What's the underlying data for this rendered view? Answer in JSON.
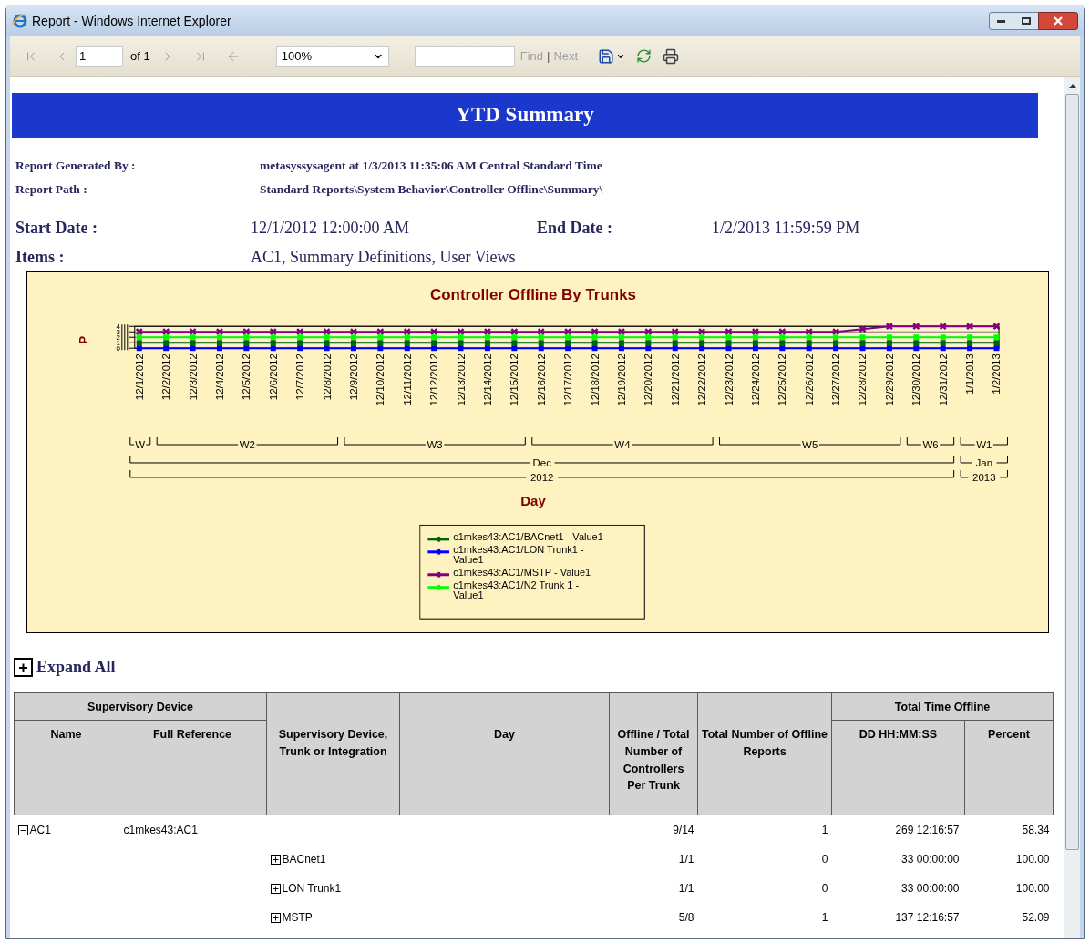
{
  "window": {
    "title": "Report - Windows Internet Explorer"
  },
  "toolbar": {
    "nav": [
      {
        "kind": "first",
        "disabled": true
      },
      {
        "kind": "prev",
        "disabled": true
      }
    ],
    "page": "1",
    "page_count": "of 1",
    "nav_after": [
      {
        "kind": "next",
        "disabled": true
      },
      {
        "kind": "last",
        "disabled": true
      },
      {
        "kind": "back",
        "disabled": true
      }
    ],
    "zoom": "100%",
    "find_label": "Find",
    "find_separator": "|",
    "next_label": "Next",
    "find_disabled": true
  },
  "report": {
    "title": "YTD Summary",
    "meta": [
      {
        "label": "Report Generated By :",
        "value": "metasyssysagent at 1/3/2013 11:35:06 AM Central Standard Time"
      },
      {
        "label": "Report Path :",
        "value": "Standard Reports\\System Behavior\\Controller Offline\\Summary\\"
      }
    ],
    "start_label": "Start Date :",
    "start_value": "12/1/2012 12:00:00 AM",
    "end_label": "End Date :",
    "end_value": "1/2/2013 11:59:59 PM",
    "items_label": "Items :",
    "items_value": "AC1, Summary Definitions, User Views"
  },
  "chart": {
    "chart_data": {
      "type": "line",
      "title": "Controller Offline By Trunks",
      "ylabel": "P",
      "grid": true,
      "legend": "bottom",
      "categories": [
        "12/1/2012",
        "12/2/2012",
        "12/3/2012",
        "12/4/2012",
        "12/5/2012",
        "12/6/2012",
        "12/7/2012",
        "12/8/2012",
        "12/9/2012",
        "12/10/2012",
        "12/11/2012",
        "12/12/2012",
        "12/13/2012",
        "12/14/2012",
        "12/15/2012",
        "12/16/2012",
        "12/17/2012",
        "12/18/2012",
        "12/19/2012",
        "12/20/2012",
        "12/21/2012",
        "12/22/2012",
        "12/23/2012",
        "12/24/2012",
        "12/25/2012",
        "12/26/2012",
        "12/27/2012",
        "12/28/2012",
        "12/29/2012",
        "12/30/2012",
        "12/31/2012",
        "1/1/2013",
        "1/2/2013"
      ],
      "series": [
        {
          "name": "c1mkes43:AC1/BACnet1 - Value1",
          "color": "#006400",
          "marker": "square",
          "values": [
            1,
            1,
            1,
            1,
            1,
            1,
            1,
            1,
            1,
            1,
            1,
            1,
            1,
            1,
            1,
            1,
            1,
            1,
            1,
            1,
            1,
            1,
            1,
            1,
            1,
            1,
            1,
            1,
            1,
            1,
            1,
            1,
            1
          ]
        },
        {
          "name": "c1mkes43:AC1/LON Trunk1 - Value1",
          "color": "#0000ff",
          "marker": "square",
          "values": [
            0,
            0,
            0,
            0,
            0,
            0,
            0,
            0,
            0,
            0,
            0,
            0,
            0,
            0,
            0,
            0,
            0,
            0,
            0,
            0,
            0,
            0,
            0,
            0,
            0,
            0,
            0,
            0,
            0,
            0,
            0,
            0,
            0
          ]
        },
        {
          "name": "c1mkes43:AC1/MSTP - Value1",
          "color": "#800080",
          "marker": "x",
          "values": [
            3,
            3,
            3,
            3,
            3,
            3,
            3,
            3,
            3,
            3,
            3,
            3,
            3,
            3,
            3,
            3,
            3,
            3,
            3,
            3,
            3,
            3,
            3,
            3,
            3,
            3,
            3,
            3.5,
            4,
            4,
            4,
            4,
            4
          ]
        },
        {
          "name": "c1mkes43:AC1/N2 Trunk 1 - Value1",
          "color": "#00ff00",
          "marker": "square",
          "values": [
            2,
            2,
            2,
            2,
            2,
            2,
            2,
            2,
            2,
            2,
            2,
            2,
            2,
            2,
            2,
            2,
            2,
            2,
            2,
            2,
            2,
            2,
            2,
            2,
            2,
            2,
            2,
            2,
            2,
            2,
            2,
            2,
            2
          ]
        }
      ],
      "ylim": [
        0,
        4
      ],
      "yticks": [
        0,
        1,
        2,
        3,
        4
      ]
    },
    "day_caption": "Day",
    "axis_groups": [
      {
        "kind": "week",
        "labels": [
          "W",
          "W2",
          "W3",
          "W4",
          "W5",
          "W6",
          "W1"
        ]
      },
      {
        "kind": "month",
        "labels": [
          "Dec",
          "Jan"
        ]
      },
      {
        "kind": "year",
        "labels": [
          "2012",
          "2013"
        ]
      }
    ]
  },
  "expand_all": {
    "icon": "+",
    "label": "Expand All"
  },
  "table": {
    "header": [
      {
        "kind": "group",
        "label": "Supervisory Device",
        "columns": [
          "Name",
          "Full Reference"
        ]
      },
      {
        "kind": "single",
        "label": "Supervisory Device, Trunk or Integration"
      },
      {
        "kind": "single",
        "label": "Day"
      },
      {
        "kind": "single",
        "label": "Offline / Total Number of Controllers Per Trunk"
      },
      {
        "kind": "single",
        "label": "Total Number of Offline Reports"
      },
      {
        "kind": "group",
        "label": "Total Time Offline",
        "columns": [
          "DD HH:MM:SS",
          "Percent"
        ]
      }
    ],
    "rows": [
      {
        "name": "AC1",
        "full_reference": "c1mkes43:AC1",
        "expanded": true,
        "offline": "9/14",
        "reports": "1",
        "duration": "269 12:16:57",
        "percent": "58.34",
        "children": [
          {
            "trunk": "BACnet1",
            "expanded": false,
            "offline": "1/1",
            "reports": "0",
            "duration": "33 00:00:00",
            "percent": "100.00"
          },
          {
            "trunk": "LON Trunk1",
            "expanded": false,
            "offline": "1/1",
            "reports": "0",
            "duration": "33 00:00:00",
            "percent": "100.00"
          },
          {
            "trunk": "MSTP",
            "expanded": false,
            "offline": "5/8",
            "reports": "1",
            "duration": "137 12:16:57",
            "percent": "52.09"
          }
        ]
      }
    ]
  }
}
